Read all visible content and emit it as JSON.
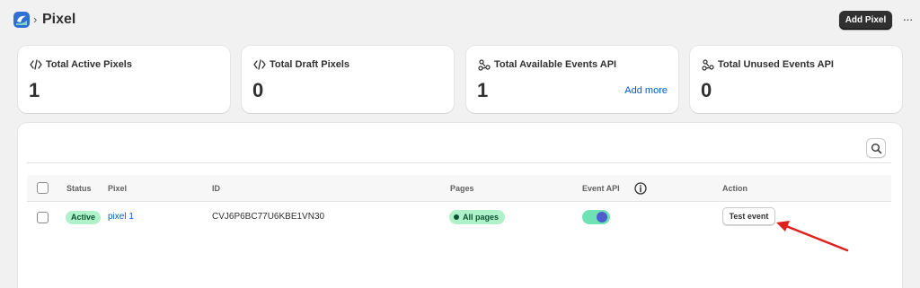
{
  "header": {
    "title": "Pixel",
    "separator": "›",
    "add_button": "Add Pixel",
    "more_label": "···"
  },
  "stats": [
    {
      "label": "Total Active Pixels",
      "value": "1",
      "icon": "code-icon"
    },
    {
      "label": "Total Draft Pixels",
      "value": "0",
      "icon": "code-icon"
    },
    {
      "label": "Total Available Events API",
      "value": "1",
      "icon": "webhook-icon",
      "link": "Add more"
    },
    {
      "label": "Total Unused Events API",
      "value": "0",
      "icon": "webhook-icon"
    }
  ],
  "table": {
    "columns": {
      "status": "Status",
      "pixel": "Pixel",
      "id": "ID",
      "pages": "Pages",
      "event_api": "Event API",
      "action": "Action"
    },
    "rows": [
      {
        "status": "Active",
        "pixel": "pixel 1",
        "id": "CVJ6P6BC77U6KBE1VN30",
        "pages": "All pages",
        "event_api_enabled": true,
        "action": "Test event"
      }
    ]
  },
  "colors": {
    "accent_dark": "#303030",
    "link": "#005bd3",
    "success_bg": "#aff2c9",
    "toggle_on": "#6ee2b4",
    "annotation_arrow": "#e0201b"
  }
}
